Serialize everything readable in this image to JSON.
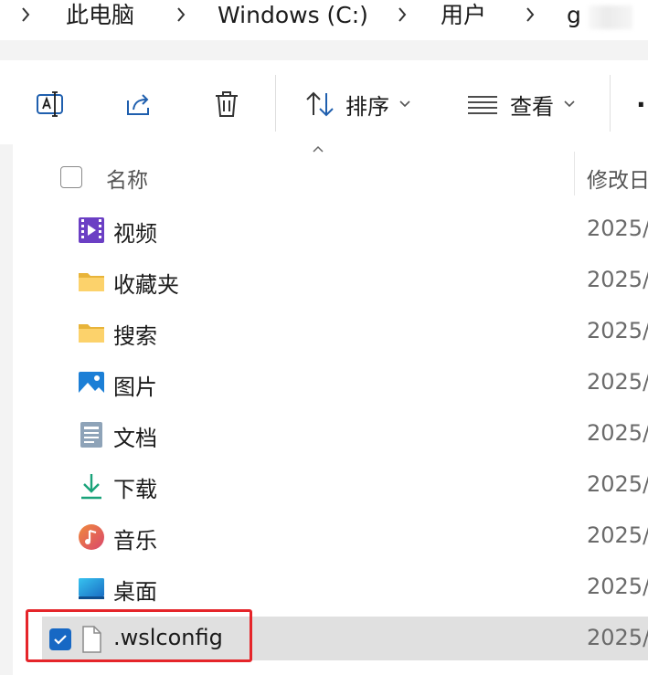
{
  "breadcrumb": {
    "segments": [
      "此电脑",
      "Windows (C:)",
      "用户",
      "g"
    ]
  },
  "toolbar": {
    "sort_label": "排序",
    "view_label": "查看",
    "more_label": "·"
  },
  "columns": {
    "name": "名称",
    "date": "修改日"
  },
  "rows": [
    {
      "name": "视频",
      "date": "2025/",
      "icon": "videos-folder-icon"
    },
    {
      "name": "收藏夹",
      "date": "2025/",
      "icon": "folder-icon"
    },
    {
      "name": "搜索",
      "date": "2025/",
      "icon": "folder-icon"
    },
    {
      "name": "图片",
      "date": "2025/",
      "icon": "pictures-folder-icon"
    },
    {
      "name": "文档",
      "date": "2025/",
      "icon": "documents-folder-icon"
    },
    {
      "name": "下载",
      "date": "2025/",
      "icon": "downloads-folder-icon"
    },
    {
      "name": "音乐",
      "date": "2025/",
      "icon": "music-folder-icon"
    },
    {
      "name": "桌面",
      "date": "2025/",
      "icon": "desktop-folder-icon"
    },
    {
      "name": ".wslconfig",
      "date": "2025/",
      "icon": "file-icon",
      "selected": true
    }
  ],
  "colors": {
    "selected_row": "#e0e0e0",
    "checkbox_accent": "#1768c4",
    "highlight_box": "#e5252a"
  }
}
